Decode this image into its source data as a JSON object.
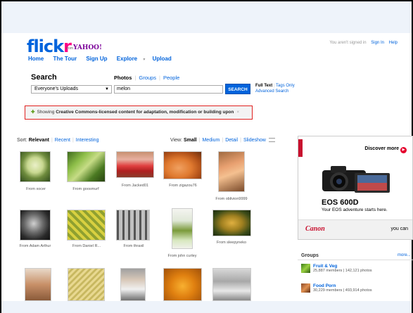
{
  "logo": {
    "flick": "flick",
    "r": "r",
    "from": "from",
    "yahoo": "YAHOO!"
  },
  "nav": {
    "home": "Home",
    "tour": "The Tour",
    "signup": "Sign Up",
    "explore": "Explore",
    "dropdown": "▾",
    "upload": "Upload"
  },
  "auth": {
    "status": "You aren't signed in",
    "sign_in": "Sign In",
    "help": "Help"
  },
  "search": {
    "title": "Search",
    "type_photos": "Photos",
    "type_groups": "Groups",
    "type_people": "People",
    "scope_value": "Everyone's Uploads",
    "query": "melon",
    "button": "SEARCH",
    "full_text": "Full Text",
    "tags_only": "Tags Only",
    "advanced": "Advanced Search"
  },
  "cc_notice": {
    "prefix": "Showing ",
    "bold": "Creative Commons-licensed content for adaptation, modification or building upon",
    "close": "×"
  },
  "sort": {
    "label": "Sort:",
    "relevant": "Relevant",
    "recent": "Recent",
    "interesting": "Interesting"
  },
  "view": {
    "label": "View:",
    "small": "Small",
    "medium": "Medium",
    "detail": "Detail",
    "slideshow": "Slideshow"
  },
  "photos": [
    {
      "caption": "From xocer"
    },
    {
      "caption": "From goosmurf"
    },
    {
      "caption": "From Jacked01"
    },
    {
      "caption": "From zigazou76"
    },
    {
      "caption": "From oblivion9999"
    },
    {
      "caption": "From Adam Arthur"
    },
    {
      "caption": "From Daniel R..."
    },
    {
      "caption": "From thraxil"
    },
    {
      "caption": "From john curley"
    },
    {
      "caption": "From sleepyneko"
    }
  ],
  "ad": {
    "discover": "Discover more",
    "model": "EOS 600D",
    "tagline": "Your EOS adventure starts here.",
    "brand": "Canon",
    "you_can": "you can"
  },
  "groups": {
    "title": "Groups",
    "more": "more...",
    "items": [
      {
        "name": "Fruit & Veg",
        "meta": "25,887 members | 142,121 photos"
      },
      {
        "name": "Food Porn",
        "meta": "30,229 members | 493,914 photos"
      }
    ]
  }
}
